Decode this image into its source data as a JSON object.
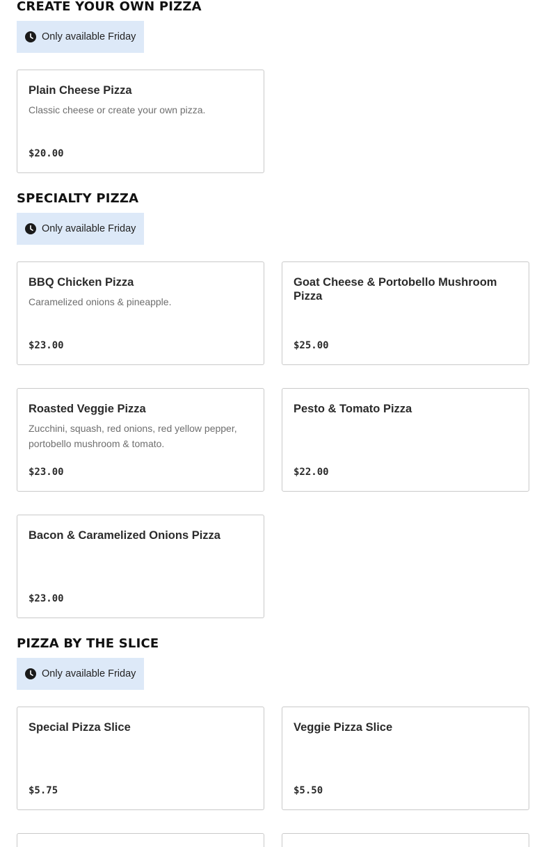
{
  "sections": [
    {
      "title": "CREATE YOUR OWN PIZZA",
      "availability": "Only available Friday",
      "items": [
        {
          "name": "Plain Cheese Pizza",
          "description": "Classic cheese or create your own pizza.",
          "price": "$20.00"
        }
      ]
    },
    {
      "title": "SPECIALTY PIZZA",
      "availability": "Only available Friday",
      "items": [
        {
          "name": "BBQ Chicken Pizza",
          "description": "Caramelized onions & pineapple.",
          "price": "$23.00"
        },
        {
          "name": "Goat Cheese & Portobello Mushroom Pizza",
          "description": "",
          "price": "$25.00"
        },
        {
          "name": "Roasted Veggie Pizza",
          "description": "Zucchini, squash, red onions, red yellow pepper, portobello mushroom & tomato.",
          "price": "$23.00"
        },
        {
          "name": "Pesto & Tomato Pizza",
          "description": "",
          "price": "$22.00"
        },
        {
          "name": "Bacon & Caramelized Onions Pizza",
          "description": "",
          "price": "$23.00"
        }
      ]
    },
    {
      "title": "PIZZA BY THE SLICE",
      "availability": "Only available Friday",
      "items": [
        {
          "name": "Special Pizza Slice",
          "description": "",
          "price": "$5.75"
        },
        {
          "name": "Veggie Pizza Slice",
          "description": "",
          "price": "$5.50"
        }
      ]
    }
  ],
  "icons": {
    "availability": "clock-icon"
  },
  "colors": {
    "badge_bg": "#dde9f8",
    "card_border": "#c9c9c9"
  }
}
